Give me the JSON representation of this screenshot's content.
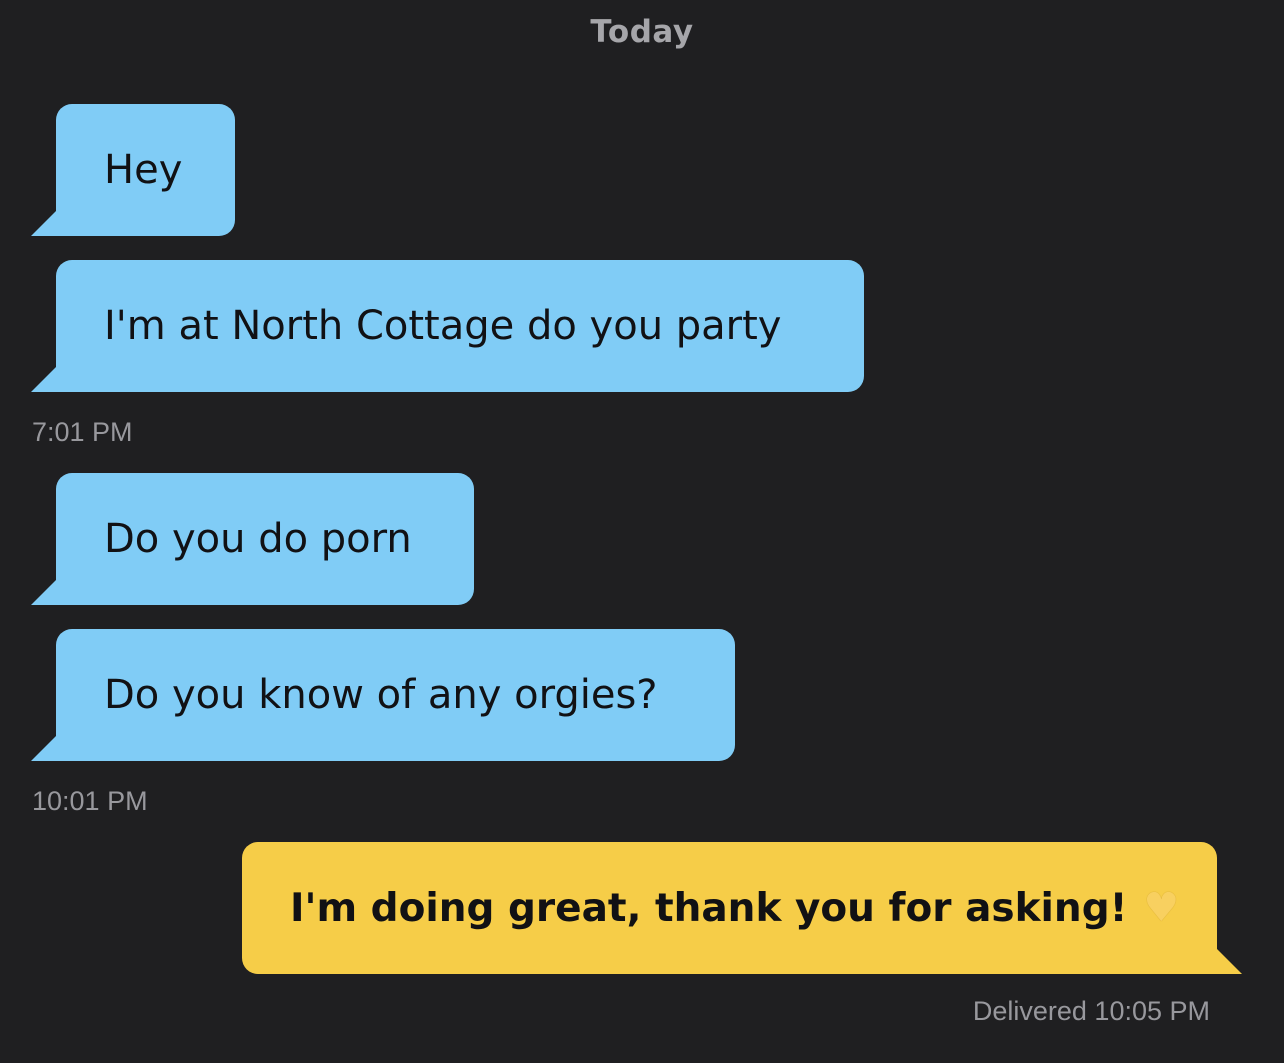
{
  "chat": {
    "date_header": "Today",
    "messages": [
      {
        "direction": "incoming",
        "text": "Hey"
      },
      {
        "direction": "incoming",
        "text": "I'm at North Cottage do you party"
      },
      {
        "direction": "incoming",
        "text": "Do you do porn"
      },
      {
        "direction": "incoming",
        "text": "Do you know of any orgies?"
      },
      {
        "direction": "outgoing",
        "text": "I'm doing great, thank you for asking!",
        "emoji": "heart-icon"
      }
    ],
    "timestamps": [
      "7:01 PM",
      "10:01 PM"
    ],
    "delivered_status": "Delivered",
    "delivered_time": "10:05 PM",
    "colors": {
      "background": "#1f1f21",
      "incoming_bubble": "#80ccf6",
      "outgoing_bubble": "#f6cd48",
      "meta_text": "#98989d"
    }
  }
}
